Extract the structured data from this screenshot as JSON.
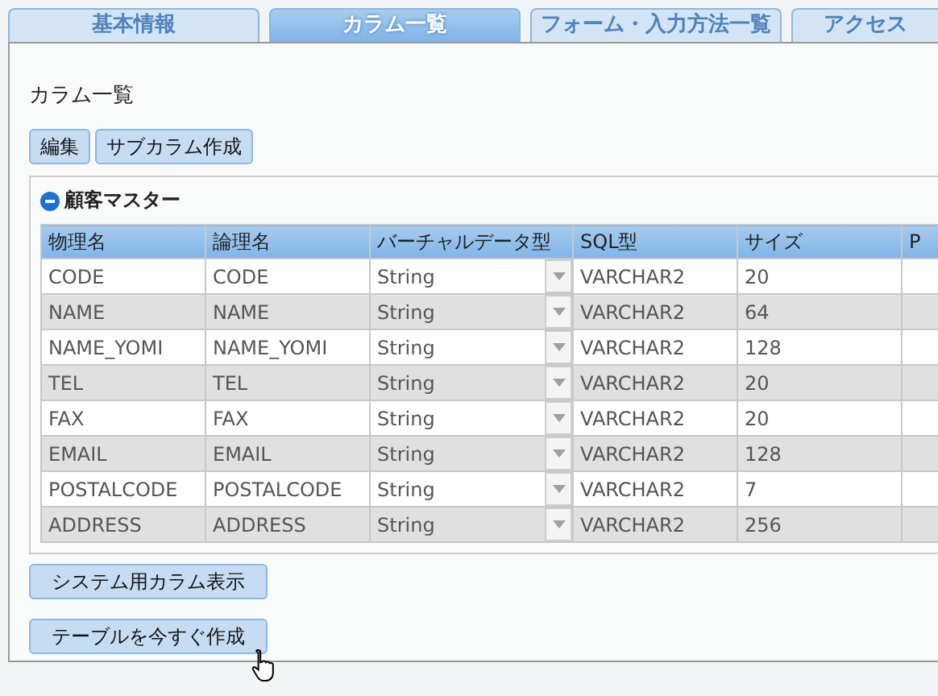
{
  "tabs": [
    {
      "label": "基本情報",
      "selected": false
    },
    {
      "label": "カラム一覧",
      "selected": true
    },
    {
      "label": "フォーム・入力方法一覧",
      "selected": false
    },
    {
      "label": "アクセス",
      "selected": false
    }
  ],
  "page_title": "カラム一覧",
  "toolbar": [
    "編集",
    "サブカラム作成"
  ],
  "section": {
    "title": "顧客マスター",
    "expanded": true
  },
  "table": {
    "columns": [
      "物理名",
      "論理名",
      "バーチャルデータ型",
      "SQL型",
      "サイズ",
      "P"
    ],
    "rows": [
      {
        "physical": "CODE",
        "logical": "CODE",
        "virtual": "String",
        "sql": "VARCHAR2",
        "size": "20"
      },
      {
        "physical": "NAME",
        "logical": "NAME",
        "virtual": "String",
        "sql": "VARCHAR2",
        "size": "64"
      },
      {
        "physical": "NAME_YOMI",
        "logical": "NAME_YOMI",
        "virtual": "String",
        "sql": "VARCHAR2",
        "size": "128"
      },
      {
        "physical": "TEL",
        "logical": "TEL",
        "virtual": "String",
        "sql": "VARCHAR2",
        "size": "20"
      },
      {
        "physical": "FAX",
        "logical": "FAX",
        "virtual": "String",
        "sql": "VARCHAR2",
        "size": "20"
      },
      {
        "physical": "EMAIL",
        "logical": "EMAIL",
        "virtual": "String",
        "sql": "VARCHAR2",
        "size": "128"
      },
      {
        "physical": "POSTALCODE",
        "logical": "POSTALCODE",
        "virtual": "String",
        "sql": "VARCHAR2",
        "size": "7"
      },
      {
        "physical": "ADDRESS",
        "logical": "ADDRESS",
        "virtual": "String",
        "sql": "VARCHAR2",
        "size": "256"
      }
    ]
  },
  "bottom_buttons": [
    "システム用カラム表示",
    "テーブルを今すぐ作成"
  ]
}
